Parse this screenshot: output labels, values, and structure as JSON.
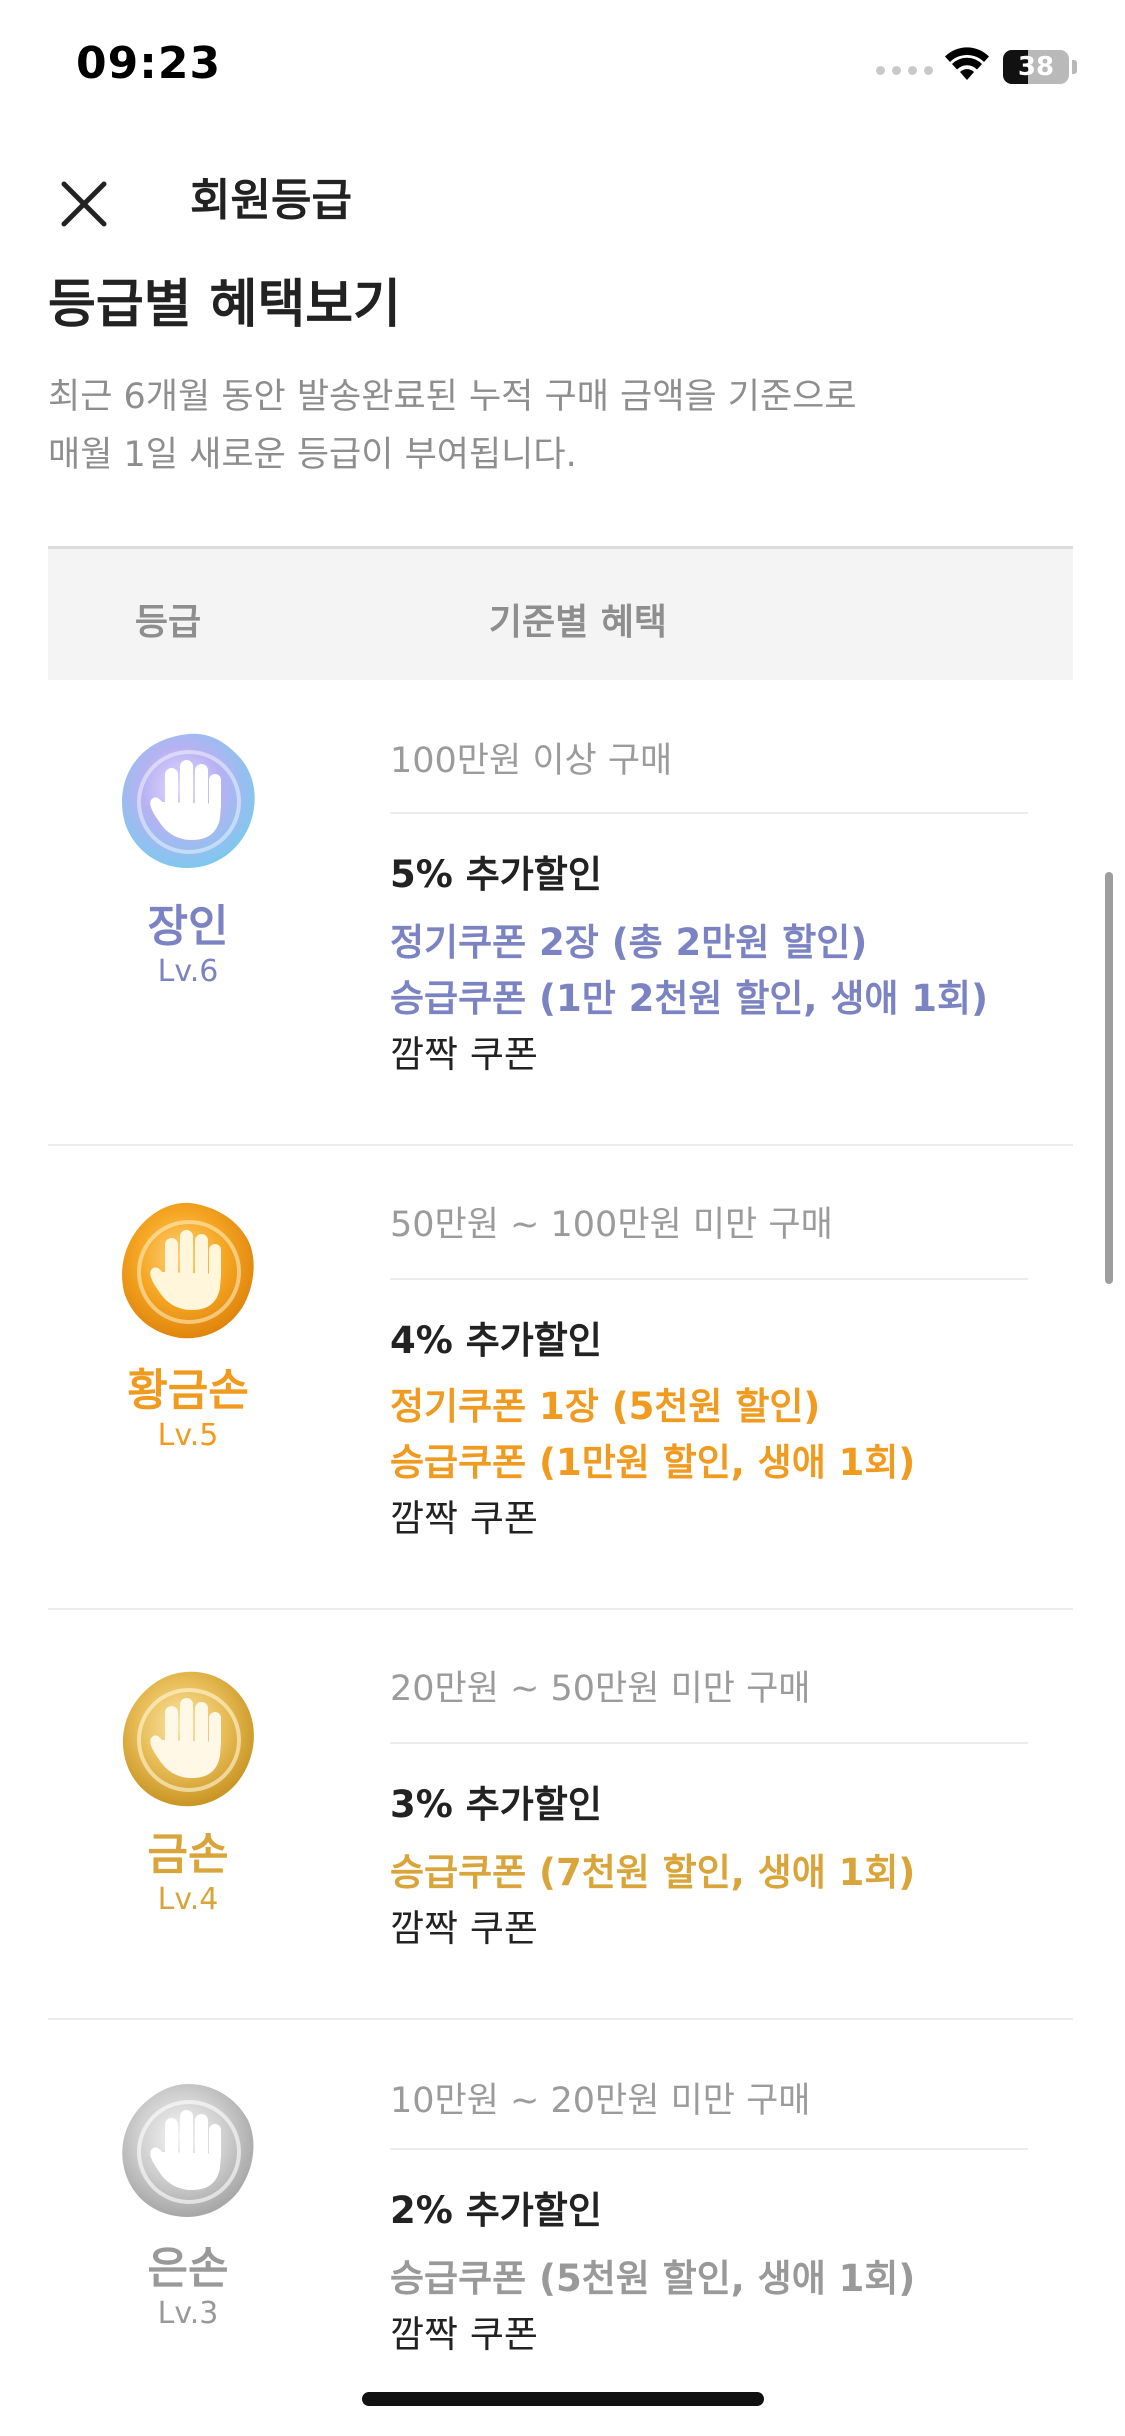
{
  "status_bar": {
    "time": "09:23",
    "battery_level": 38,
    "battery_label": "38",
    "icons": [
      "signal-dots-icon",
      "wifi-icon",
      "battery-icon"
    ]
  },
  "nav": {
    "title": "회원등급",
    "close_icon": "close-icon"
  },
  "section": {
    "title": "등급별 혜택보기",
    "description_lines": [
      "최근 6개월 동안 발송완료된 누적 구매 금액을 기준으로",
      "매월 1일 새로운 등급이 부여됩니다."
    ]
  },
  "table": {
    "headers": {
      "grade": "등급",
      "benefit": "기준별 혜택"
    },
    "tiers": [
      {
        "name": "장인",
        "level": "Lv.6",
        "color": "#7b83c2",
        "badge_icon": "artisan-hand-badge-icon",
        "criteria": "100만원 이상 구매",
        "discount": "5% 추가할인",
        "benefits": [
          "정기쿠폰 2장 (총 2만원 할인)",
          "승급쿠폰 (1만 2천원 할인, 생애 1회)"
        ],
        "surprise": "깜짝 쿠폰"
      },
      {
        "name": "황금손",
        "level": "Lv.5",
        "color": "#f09a1f",
        "badge_icon": "golden-hand-badge-icon",
        "criteria": "50만원 ~ 100만원 미만 구매",
        "discount": "4% 추가할인",
        "benefits": [
          "정기쿠폰 1장 (5천원 할인)",
          "승급쿠폰 (1만원 할인, 생애 1회)"
        ],
        "surprise": "깜짝 쿠폰"
      },
      {
        "name": "금손",
        "level": "Lv.4",
        "color": "#d9a53a",
        "badge_icon": "gold-hand-badge-icon",
        "criteria": "20만원 ~ 50만원 미만 구매",
        "discount": "3% 추가할인",
        "benefits": [
          "승급쿠폰 (7천원 할인, 생애 1회)"
        ],
        "surprise": "깜짝 쿠폰"
      },
      {
        "name": "은손",
        "level": "Lv.3",
        "color": "#999999",
        "badge_icon": "silver-hand-badge-icon",
        "criteria": "10만원 ~ 20만원 미만 구매",
        "discount": "2% 추가할인",
        "benefits": [
          "승급쿠폰 (5천원 할인, 생애 1회)"
        ],
        "surprise": "깜짝 쿠폰"
      }
    ]
  }
}
